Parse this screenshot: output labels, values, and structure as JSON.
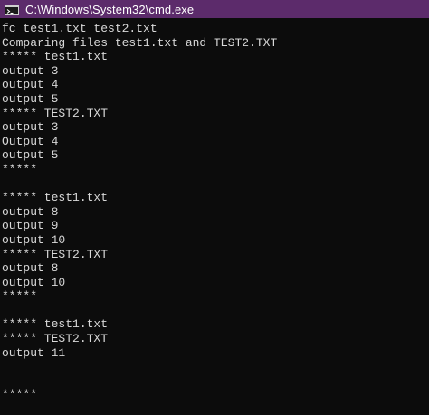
{
  "window": {
    "title": "C:\\Windows\\System32\\cmd.exe",
    "titlebar_color": "#5c2b6b",
    "background_color": "#0c0c0c",
    "text_color": "#d9d9d9",
    "icon": "console-app-icon"
  },
  "console": {
    "lines": [
      "fc test1.txt test2.txt",
      "Comparing files test1.txt and TEST2.TXT",
      "***** test1.txt",
      "output 3",
      "output 4",
      "output 5",
      "***** TEST2.TXT",
      "output 3",
      "Output 4",
      "output 5",
      "*****",
      "",
      "***** test1.txt",
      "output 8",
      "output 9",
      "output 10",
      "***** TEST2.TXT",
      "output 8",
      "output 10",
      "*****",
      "",
      "***** test1.txt",
      "***** TEST2.TXT",
      "output 11",
      "",
      "",
      "*****"
    ]
  }
}
